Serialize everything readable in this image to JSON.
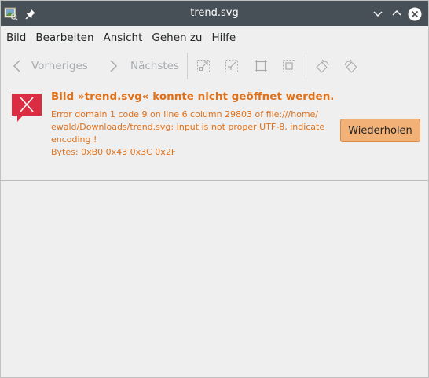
{
  "window": {
    "title": "trend.svg"
  },
  "menubar": {
    "items": [
      "Bild",
      "Bearbeiten",
      "Ansicht",
      "Gehen zu",
      "Hilfe"
    ]
  },
  "toolbar": {
    "previous_label": "Vorheriges",
    "next_label": "Nächstes",
    "icons": [
      "zoom-fit-icon",
      "zoom-in-fit-icon",
      "actual-size-icon",
      "zoom-fill-icon",
      "rotate-left-icon",
      "rotate-right-icon"
    ]
  },
  "error": {
    "title": "Bild »trend.svg« konnte nicht geöffnet werden.",
    "detail_lines": [
      "Error domain 1 code 9 on line 6 column 29803 of file:///home/",
      "ewald/Downloads/trend.svg: Input is not proper UTF-8, indicate",
      "encoding !",
      "Bytes: 0xB0 0x43 0x3C 0x2F"
    ],
    "retry_label": "Wiederholen",
    "accent_color": "#e0711b"
  },
  "colors": {
    "titlebar": "#475057",
    "button": "#f2b176",
    "error_icon": "#da2d43"
  }
}
